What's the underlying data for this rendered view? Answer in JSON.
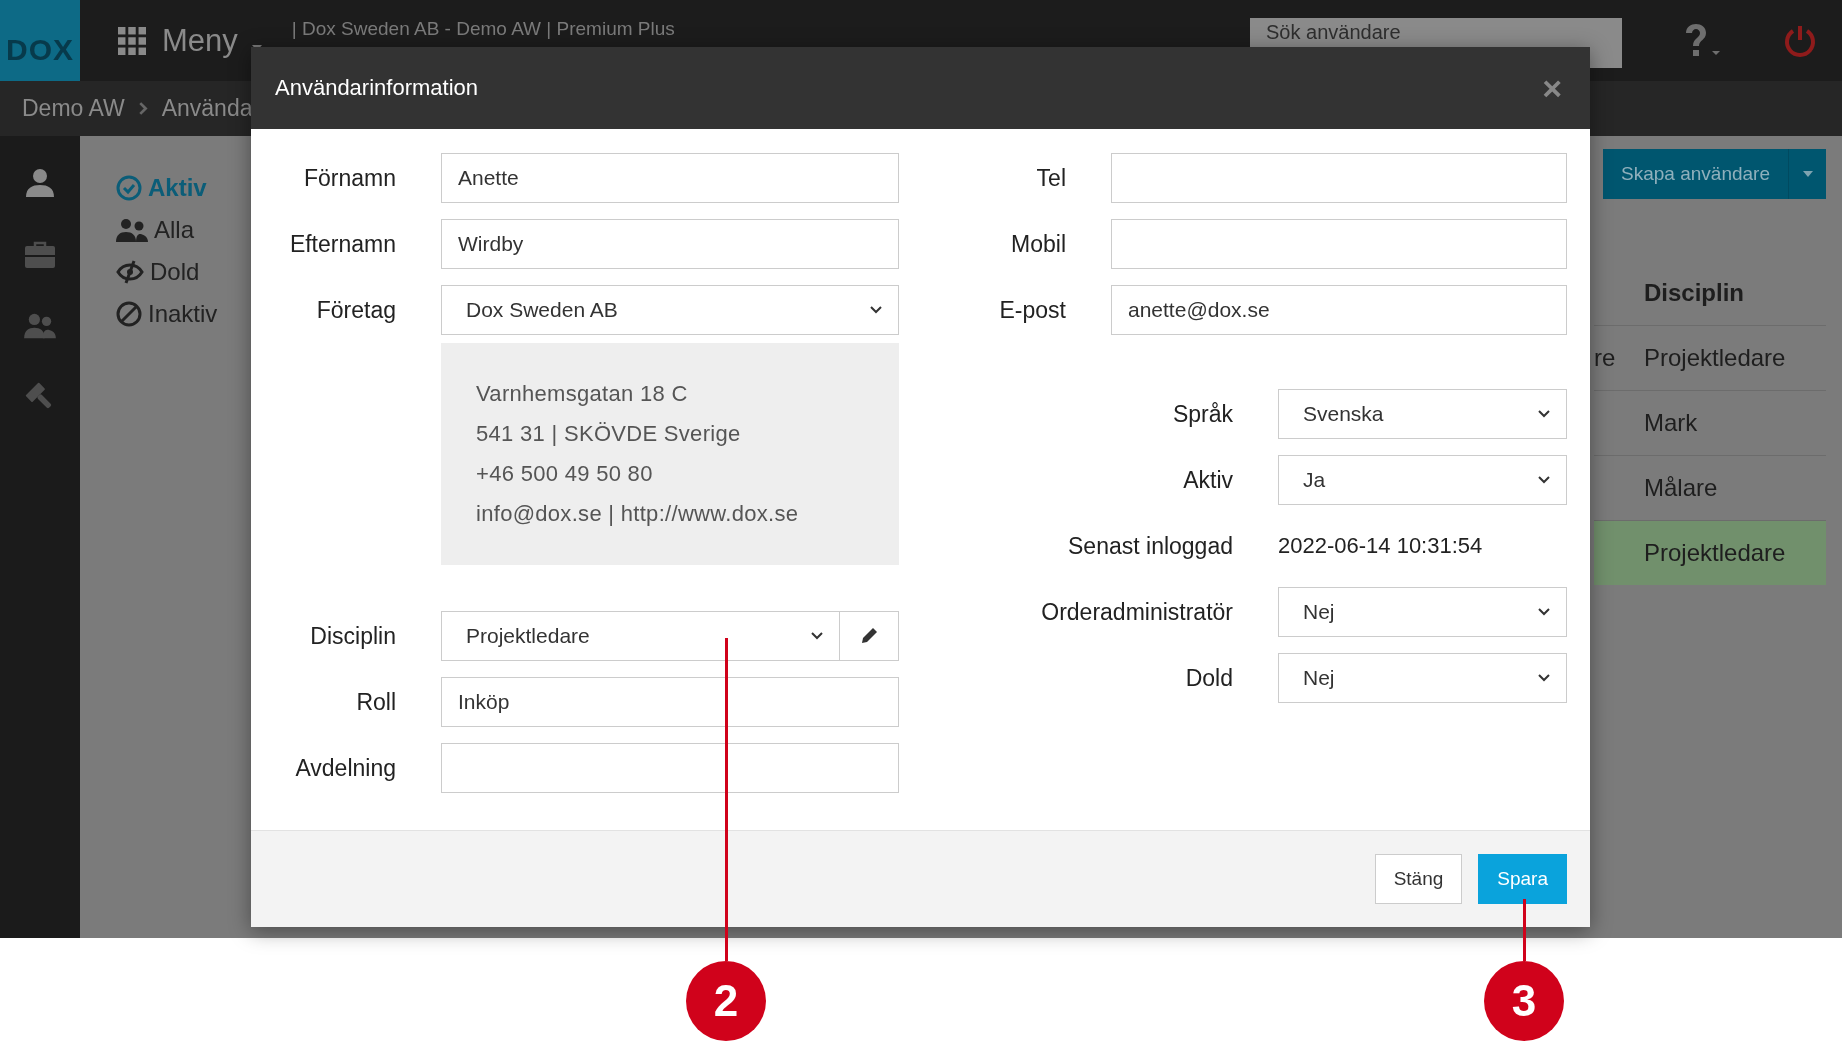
{
  "topbar": {
    "logo": "DOX",
    "menu_label": "Meny",
    "context": "| Dox Sweden AB - Demo AW | Premium Plus",
    "search": {
      "placeholder": "Sök användare"
    }
  },
  "breadcrumb": [
    "Demo AW",
    "Använda"
  ],
  "filters": [
    {
      "label": "Aktiv",
      "kind": "active",
      "selected": true
    },
    {
      "label": "Alla",
      "kind": "all",
      "selected": false
    },
    {
      "label": "Dold",
      "kind": "hidden",
      "selected": false
    },
    {
      "label": "Inaktiv",
      "kind": "inactive",
      "selected": false
    }
  ],
  "create_button": {
    "label": "Skapa användare"
  },
  "table": {
    "header": "Disciplin",
    "rows": [
      {
        "column_1": "re",
        "disciplin": "Projektledare",
        "selected": false
      },
      {
        "disciplin": "Mark",
        "selected": false
      },
      {
        "disciplin": "Målare",
        "selected": false
      },
      {
        "disciplin": "Projektledare",
        "selected": true
      }
    ]
  },
  "dialog": {
    "title": "Användarinformation",
    "close": "×",
    "left": [
      {
        "label": "Förnamn",
        "kind": "text",
        "value": "Anette"
      },
      {
        "label": "Efternamn",
        "kind": "text",
        "value": "Wirdby"
      },
      {
        "label": "Företag",
        "kind": "select",
        "value": "Dox Sweden AB"
      }
    ],
    "company_card": [
      "Varnhemsgatan 18 C",
      "541 31 | SKÖVDE Sverige",
      "+46 500 49 50 80",
      "info@dox.se | http://www.dox.se"
    ],
    "left_lower": [
      {
        "label": "Disciplin",
        "kind": "select_edit",
        "value": "Projektledare"
      },
      {
        "label": "Roll",
        "kind": "text",
        "value": "Inköp"
      },
      {
        "label": "Avdelning",
        "kind": "text"
      }
    ],
    "right": [
      {
        "label": "Tel",
        "kind": "text"
      },
      {
        "label": "Mobil",
        "kind": "text"
      },
      {
        "label": "E-post",
        "kind": "text",
        "value": "anette@dox.se"
      }
    ],
    "right_lower": [
      {
        "label": "Språk",
        "kind": "select",
        "value": "Svenska"
      },
      {
        "label": "Aktiv",
        "kind": "select",
        "value": "Ja"
      },
      {
        "label": "Senast inloggad",
        "kind": "static",
        "value": "2022-06-14 10:31:54"
      },
      {
        "label": "Orderadministratör",
        "kind": "select",
        "value": "Nej"
      },
      {
        "label": "Dold",
        "kind": "select",
        "value": "Nej"
      }
    ],
    "buttons": [
      {
        "label": "Stäng",
        "kind": "secondary"
      },
      {
        "label": "Spara",
        "kind": "primary"
      }
    ]
  },
  "callouts": [
    {
      "label": "2"
    },
    {
      "label": "3"
    }
  ]
}
